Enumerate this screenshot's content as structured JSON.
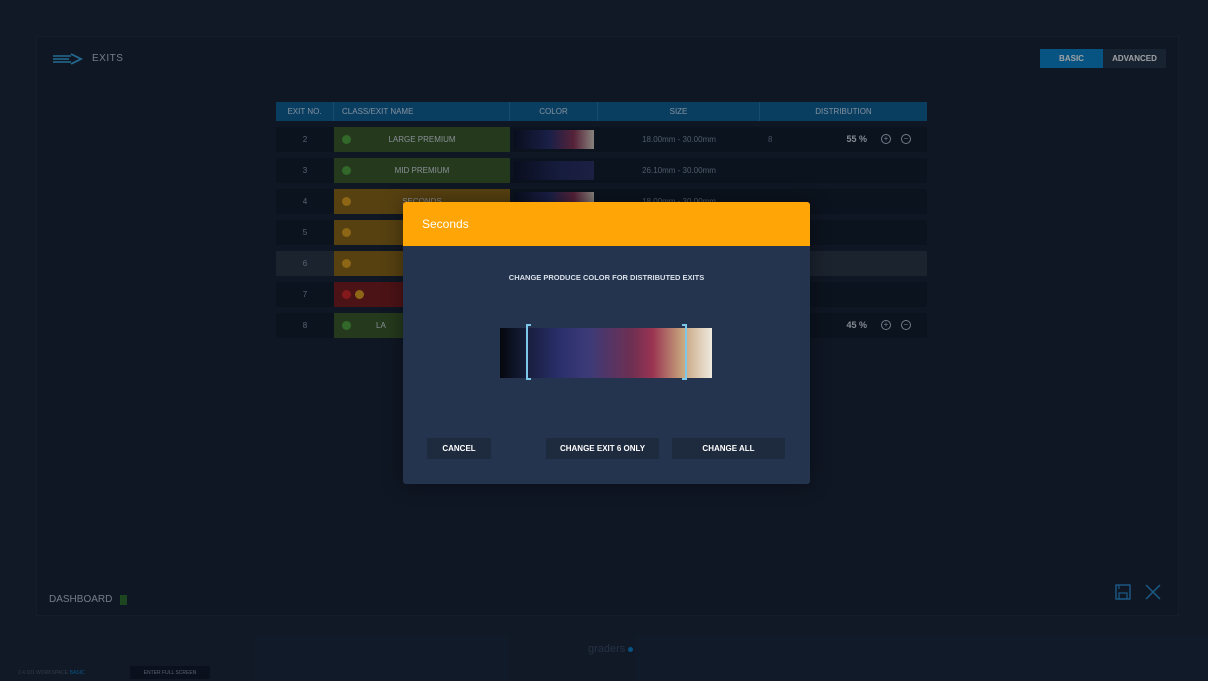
{
  "header": {
    "title": "EXITS"
  },
  "mode_toggle": {
    "basic": "BASIC",
    "advanced": "ADVANCED"
  },
  "table": {
    "columns": [
      "EXIT NO.",
      "CLASS/EXIT NAME",
      "COLOR",
      "SIZE",
      "DISTRIBUTION"
    ],
    "rows": [
      {
        "exit_no": "2",
        "name": "LARGE PREMIUM",
        "size": "18.00mm - 30.00mm",
        "lane": "8",
        "distribution": "55 %"
      },
      {
        "exit_no": "3",
        "name": "MID PREMIUM",
        "size": "26.10mm - 30.00mm",
        "lane": "",
        "distribution": ""
      },
      {
        "exit_no": "4",
        "name": "SECONDS",
        "size": "18.00mm - 30.00mm",
        "lane": "",
        "distribution": ""
      },
      {
        "exit_no": "5",
        "name": "",
        "size": "",
        "lane": "",
        "distribution": ""
      },
      {
        "exit_no": "6",
        "name": "",
        "size": "",
        "lane": "",
        "distribution": ""
      },
      {
        "exit_no": "7",
        "name": "",
        "size": "",
        "lane": "",
        "distribution": ""
      },
      {
        "exit_no": "8",
        "name": "LA",
        "size": "",
        "lane": "",
        "distribution": "45 %"
      }
    ]
  },
  "dashboard": {
    "label": "DASHBOARD"
  },
  "footer": {
    "brand": "graders",
    "version": "2.4.101 WORKSPACE",
    "workspace": "BASIC",
    "fullscreen": "ENTER FULL SCREEN"
  },
  "modal": {
    "title": "Seconds",
    "subtitle": "CHANGE PRODUCE COLOR FOR DISTRIBUTED EXITS",
    "cancel": "CANCEL",
    "change_one": "CHANGE EXIT 6 ONLY",
    "change_all": "CHANGE ALL"
  },
  "colors": {
    "accent": "#0b84c9",
    "header_orange": "#ffa505",
    "green": "#4fa33a",
    "red": "#d42424"
  }
}
